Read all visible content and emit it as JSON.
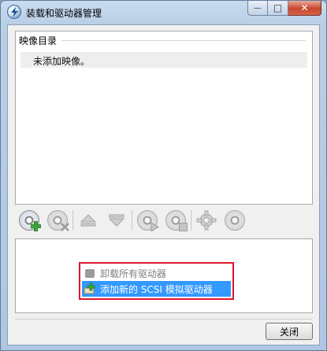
{
  "window": {
    "title": "装载和驱动器管理",
    "min_symbol": "—",
    "max_symbol": "□",
    "close_symbol": "✕"
  },
  "image_list": {
    "header": "映像目录",
    "empty_message": "未添加映像。"
  },
  "toolbar": {
    "icons": [
      "add-image-icon",
      "remove-image-icon",
      "move-up-icon",
      "move-down-icon",
      "mount-play-icon",
      "unmount-icon",
      "settings-gear-icon",
      "burn-disc-icon"
    ]
  },
  "drive_menu": {
    "items": [
      {
        "label": "卸载所有驱动器",
        "state": "disabled"
      },
      {
        "label": "添加新的 SCSI 模拟驱动器",
        "state": "selected"
      }
    ]
  },
  "footer": {
    "close_label": "关闭"
  },
  "colors": {
    "highlight": "#3399ff",
    "annotation_border": "#e0152b"
  }
}
